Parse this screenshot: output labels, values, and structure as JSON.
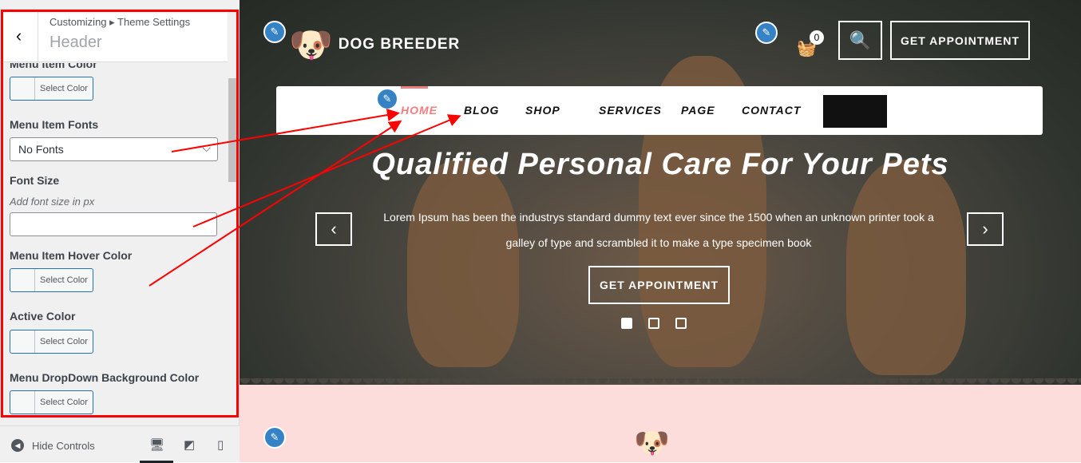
{
  "customizer": {
    "breadcrumb": "Customizing ▸ Theme Settings",
    "section_title": "Header",
    "fields": {
      "menu_item_color": "Menu Item Color",
      "menu_item_fonts": "Menu Item Fonts",
      "menu_item_fonts_value": "No Fonts",
      "font_size": "Font Size",
      "font_size_hint": "Add font size in px",
      "menu_item_hover_color": "Menu Item Hover Color",
      "active_color": "Active Color",
      "menu_dropdown_bg_color": "Menu DropDown Background Color"
    },
    "select_color": "Select Color",
    "hide_controls": "Hide Controls"
  },
  "site": {
    "logo_text": "DOG BREEDER",
    "cart_count": "0",
    "appointment": "GET APPOINTMENT",
    "nav": [
      "HOME",
      "BLOG",
      "SHOP",
      "SERVICES",
      "PAGE",
      "CONTACT"
    ],
    "active_nav": "HOME",
    "hero_title": "Qualified Personal Care For Your Pets",
    "hero_text": "Lorem Ipsum has been the industrys standard dummy text ever since the 1500 when an unknown printer took a galley of type and scrambled it to make a type specimen book",
    "hero_cta": "GET APPOINTMENT",
    "slides": 3,
    "active_slide": 1
  },
  "colors": {
    "accent": "#f08080",
    "highlight": "#ff0000",
    "wp_blue": "#2271b1",
    "pink_bg": "#fddcdc"
  }
}
